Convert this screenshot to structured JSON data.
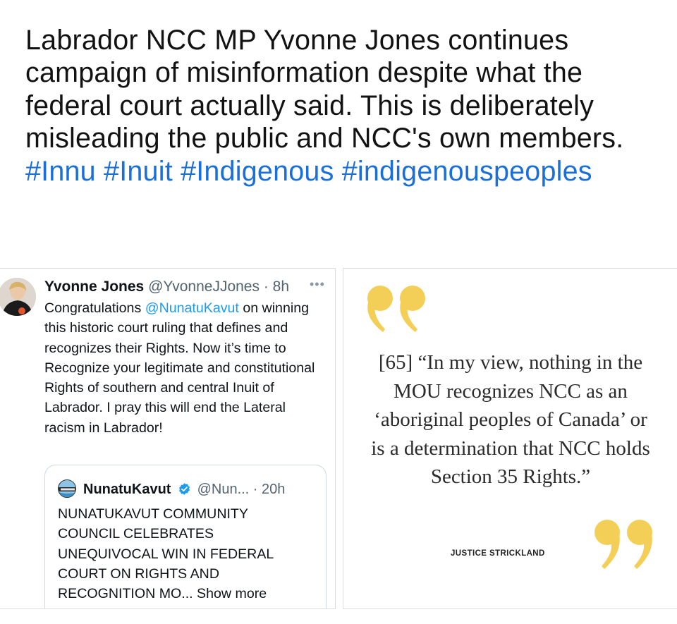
{
  "post": {
    "text": "Labrador NCC MP Yvonne Jones continues campaign of misinformation despite what the federal court actually said.  This is deliberately misleading the public and NCC's own members.",
    "hashtags": [
      "#Innu",
      "#Inuit",
      "#Indigenous",
      "#indigenouspeoples"
    ]
  },
  "tweet": {
    "name": "Yvonne Jones",
    "handle": "@YvonneJJones",
    "time": "8h",
    "more_icon": "more-horizontal-icon",
    "body_prefix": "Congratulations ",
    "mention": "@NunatuKavut",
    "body_suffix": " on winning this historic court ruling that defines and recognizes their Rights. Now it’s time to Recognize your legitimate and constitutional Rights of southern and central Inuit of Labrador. I pray this will end the Lateral racism in Labrador!",
    "quoted": {
      "name": "NunatuKavut",
      "handle": "@Nun...",
      "time": "20h",
      "verified_color": "#1d9bf0",
      "body": "NUNATUKAVUT COMMUNITY COUNCIL CELEBRATES UNEQUIVOCAL WIN IN FEDERAL COURT ON RIGHTS AND RECOGNITION MO...",
      "show_more": "Show more"
    }
  },
  "quote_image": {
    "quote": "[65] “In my view, nothing in the MOU recognizes NCC as an ‘aboriginal peoples of Canada’ or is a determination that NCC holds Section 35 Rights.”",
    "attribution": "JUSTICE STRICKLAND",
    "accent_color": "#f4cf57"
  }
}
